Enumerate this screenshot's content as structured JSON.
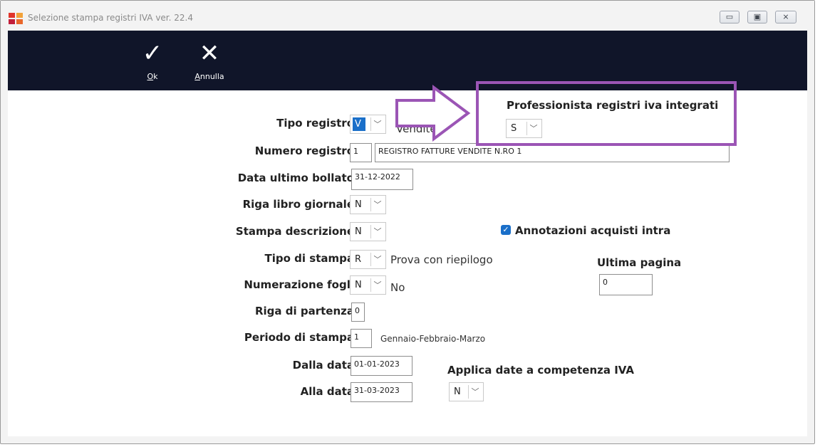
{
  "window": {
    "title": "Selezione stampa registri IVA  ver. 22.4",
    "min_label": "▭",
    "max_label": "▣",
    "close_label": "⨯"
  },
  "toolbar": {
    "ok_label_prefix": "O",
    "ok_label_rest": "k",
    "cancel_label_prefix": "A",
    "cancel_label_rest": "nnulla",
    "ok_glyph": "✓",
    "cancel_glyph": "✕"
  },
  "form": {
    "tipo_registro_label": "Tipo registro",
    "tipo_registro_value": "V",
    "tipo_registro_desc": "Vendite",
    "numero_registro_label": "Numero registro",
    "numero_registro_value": "1",
    "numero_registro_desc": "REGISTRO FATTURE VENDITE N.RO  1",
    "data_ultimo_bollato_label": "Data ultimo bollato",
    "data_ultimo_bollato_value": "31-12-2022",
    "riga_libro_label": "Riga libro giornale",
    "riga_libro_value": "N",
    "stampa_descrizione_label": "Stampa descrizione",
    "stampa_descrizione_value": "N",
    "tipo_stampa_label": "Tipo di stampa",
    "tipo_stampa_value": "R",
    "tipo_stampa_desc": "Prova con riepilogo",
    "numerazione_fogli_label": "Numerazione fogli",
    "numerazione_fogli_value": "N",
    "numerazione_fogli_desc": "No",
    "riga_partenza_label": "Riga di partenza",
    "riga_partenza_value": "0",
    "periodo_label": "Periodo di stampa",
    "periodo_value": "1",
    "periodo_desc": "Gennaio-Febbraio-Marzo",
    "dalla_data_label": "Dalla data",
    "dalla_data_value": "01-01-2023",
    "alla_data_label": "Alla data",
    "alla_data_value": "31-03-2023"
  },
  "right": {
    "professionista_label": "Professionista registri iva integrati",
    "professionista_value": "S",
    "annotazioni_label": "Annotazioni acquisti intra",
    "annotazioni_checked": true,
    "ultima_pagina_label": "Ultima pagina",
    "ultima_pagina_value": "0",
    "applica_label": "Applica date a competenza IVA",
    "applica_value": "N"
  },
  "colors": {
    "toolbar_bg": "#101529",
    "accent_blue": "#1a6fc9",
    "highlight_purple": "#9b55b5"
  }
}
